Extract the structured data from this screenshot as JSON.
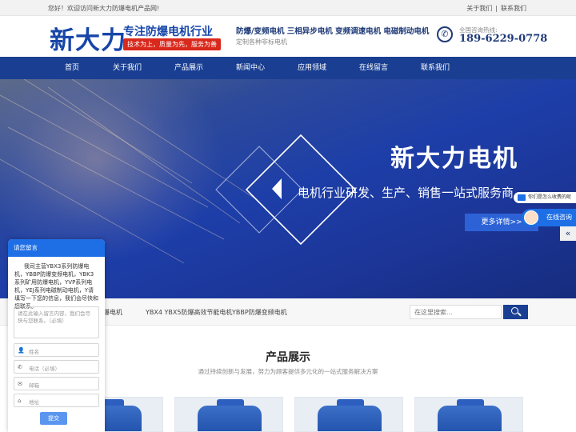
{
  "topbar": {
    "welcome": "您好！欢迎访问新大力防爆电机产品网!",
    "links": [
      "关于我们",
      "联系我们"
    ]
  },
  "header": {
    "logo_text": "新大力",
    "logo_slogan": "专注防爆电机行业",
    "logo_tagline": "技术为上，质量为先，服务为善",
    "products_line": "防爆/变频电机 三相异步电机 变频调速电机 电磁制动电机",
    "custom_line": "定制各种非标电机",
    "hotline_label": "全国咨询热线:",
    "hotline": "189-6229-0778"
  },
  "nav": {
    "items": [
      "首页",
      "关于我们",
      "产品展示",
      "新闻中心",
      "应用领域",
      "在线留言",
      "联系我们"
    ]
  },
  "banner": {
    "title": "新大力电机",
    "subtitle": "电机行业研发、生产、销售一站式服务商",
    "more": "更多详情>>"
  },
  "categories": {
    "items": [
      "YBX3防爆电机",
      "YBX4 YBX5防爆高效节能电机",
      "YBBP防爆变频电机"
    ]
  },
  "search": {
    "placeholder": "在这里搜索..."
  },
  "products": {
    "title": "产品展示",
    "subtitle": "通过持续创新与发展，努力为顾客提供多元化的一站式服务解决方案"
  },
  "message_form": {
    "header": "请您留言",
    "intro": "我司主营YBX3系列防爆电机，YBBP防爆变频电机，YBK3系列矿用防爆电机，YVP系列电机，YEJ系列电磁制动电机，Y请填写一下您的信息，我们会尽快和您联系。",
    "message_placeholder": "请在此输入留言内容，我们会尽快与您联系。（必填）",
    "name_placeholder": "姓名",
    "phone_placeholder": "电话（必填）",
    "email_placeholder": "邮箱",
    "address_placeholder": "地址",
    "submit": "提交"
  },
  "float_widget": {
    "bubble": "你们是怎么收费的呢",
    "online": "在线咨询",
    "collapse": "«"
  },
  "colors": {
    "primary": "#1a3f92",
    "accent": "#1e6fe6",
    "red": "#d9281c"
  }
}
